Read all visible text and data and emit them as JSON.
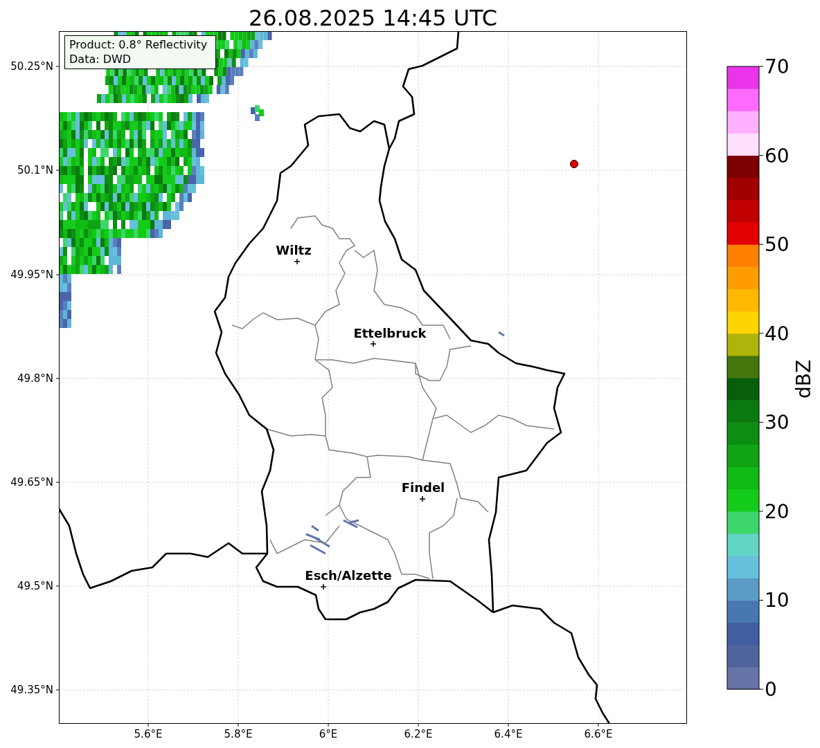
{
  "title": "26.08.2025 14:45 UTC",
  "info_box": [
    "Product: 0.8° Reflectivity",
    "Data: DWD"
  ],
  "y_ticks": [
    "50.25°N",
    "50.1°N",
    "49.95°N",
    "49.8°N",
    "49.65°N",
    "49.5°N",
    "49.35°N"
  ],
  "x_ticks": [
    "5.6°E",
    "5.8°E",
    "6°E",
    "6.2°E",
    "6.4°E",
    "6.6°E"
  ],
  "cities": [
    {
      "name": "Wiltz"
    },
    {
      "name": "Ettelbruck"
    },
    {
      "name": "Findel"
    },
    {
      "name": "Esch/Alzette"
    }
  ],
  "colorbar": {
    "label": "dBZ",
    "ticks": [
      "70",
      "60",
      "50",
      "40",
      "30",
      "20",
      "10",
      "0"
    ],
    "bins": [
      {
        "color": "#6574a7"
      },
      {
        "color": "#50649c"
      },
      {
        "color": "#415ea1"
      },
      {
        "color": "#4878b0"
      },
      {
        "color": "#5a9cc6"
      },
      {
        "color": "#67c0dc"
      },
      {
        "color": "#62d6c6"
      },
      {
        "color": "#3dd66c"
      },
      {
        "color": "#13cc1a"
      },
      {
        "color": "#10bb14"
      },
      {
        "color": "#10a314"
      },
      {
        "color": "#0c8e12"
      },
      {
        "color": "#0a7a10"
      },
      {
        "color": "#075f0b"
      },
      {
        "color": "#45760d"
      },
      {
        "color": "#b0b30a"
      },
      {
        "color": "#ffd500"
      },
      {
        "color": "#ffb900"
      },
      {
        "color": "#ff9c00"
      },
      {
        "color": "#ff7f00"
      },
      {
        "color": "#e30000"
      },
      {
        "color": "#c10000"
      },
      {
        "color": "#a20000"
      },
      {
        "color": "#7c0000"
      },
      {
        "color": "#ffe0ff"
      },
      {
        "color": "#ffb0ff"
      },
      {
        "color": "#ff6bff"
      },
      {
        "color": "#ea33ea"
      }
    ]
  }
}
